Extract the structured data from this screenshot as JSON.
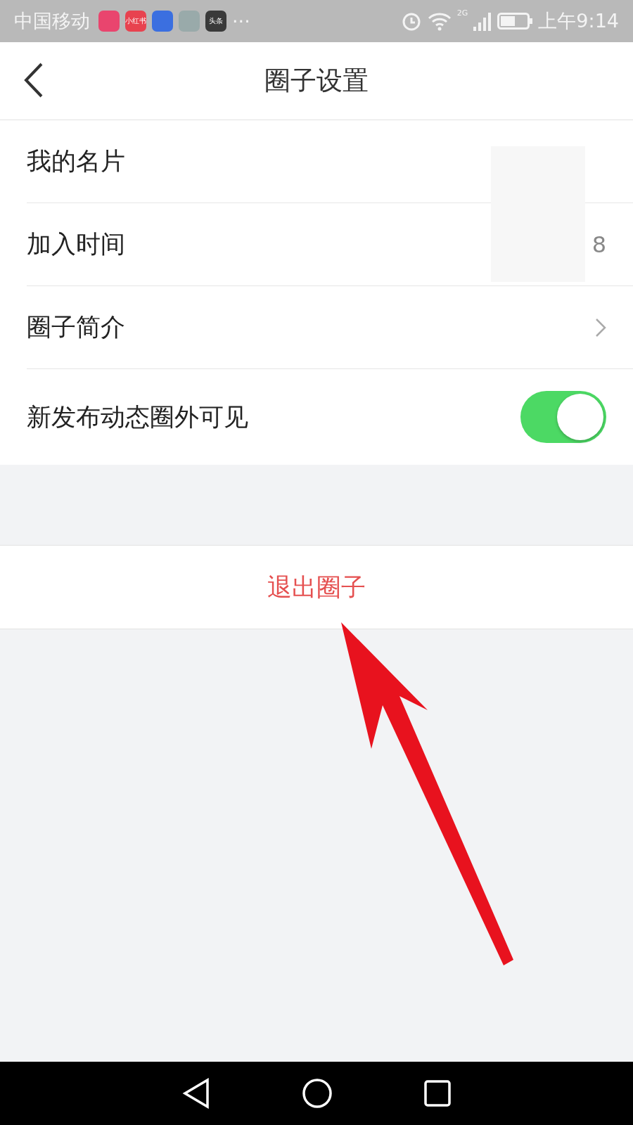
{
  "status_bar": {
    "carrier": "中国移动",
    "app_icons": [
      {
        "color": "#e9456e"
      },
      {
        "color": "#e8424f",
        "label": "小红书"
      },
      {
        "color": "#3b6fe0"
      },
      {
        "color": "#99aaaa"
      },
      {
        "color": "#3a3a3a",
        "label": "头条"
      }
    ],
    "more": "···",
    "network": "2G",
    "time": "上午9:14"
  },
  "header": {
    "title": "圈子设置"
  },
  "rows": [
    {
      "kind": "value",
      "label": "我的名片",
      "redacted": true
    },
    {
      "kind": "value",
      "label": "加入时间",
      "value": "8",
      "redacted": true
    },
    {
      "kind": "link",
      "label": "圈子简介"
    },
    {
      "kind": "toggle",
      "label": "新发布动态圈外可见",
      "on": true
    }
  ],
  "exit_button": {
    "label": "退出圈子"
  },
  "annotation": {
    "kind": "arrow"
  }
}
